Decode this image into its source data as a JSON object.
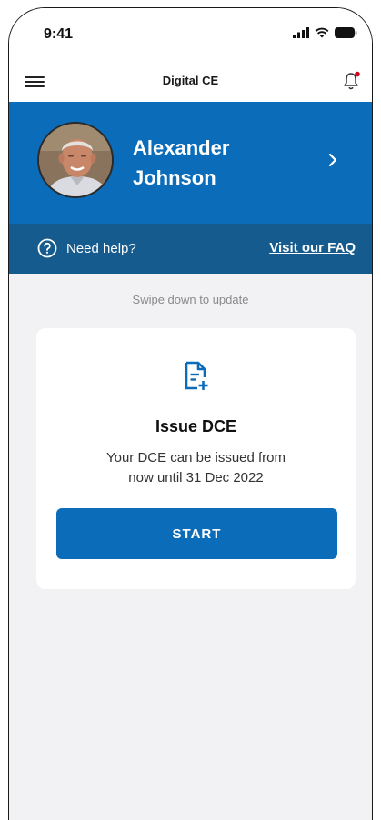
{
  "status_bar": {
    "time": "9:41"
  },
  "header": {
    "title": "Digital CE",
    "notification_dot_color": "#d0021b"
  },
  "profile": {
    "first_name": "Alexander",
    "last_name": "Johnson"
  },
  "help": {
    "text": "Need help?",
    "link": "Visit our FAQ"
  },
  "hint": "Swipe down to update",
  "card": {
    "icon": "document-add-icon",
    "title": "Issue DCE",
    "desc_line1": "Your DCE can be issued from",
    "desc_line2": "now until 31 Dec 2022",
    "button": "START"
  },
  "colors": {
    "primary": "#0b6dba",
    "help_bar": "#155b8e",
    "background": "#f2f2f4"
  }
}
